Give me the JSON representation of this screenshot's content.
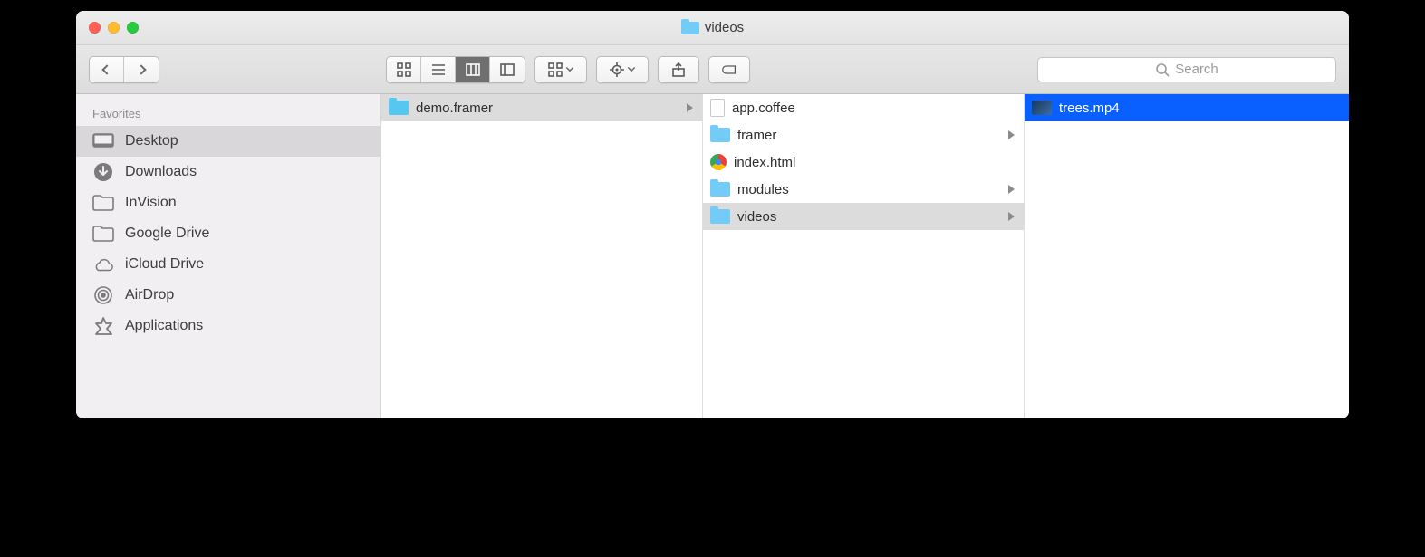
{
  "window": {
    "title": "videos"
  },
  "toolbar": {
    "search_placeholder": "Search"
  },
  "sidebar": {
    "heading": "Favorites",
    "items": [
      {
        "label": "Desktop",
        "icon": "desktop",
        "selected": true
      },
      {
        "label": "Downloads",
        "icon": "download",
        "selected": false
      },
      {
        "label": "InVision",
        "icon": "folder",
        "selected": false
      },
      {
        "label": "Google Drive",
        "icon": "folder",
        "selected": false
      },
      {
        "label": "iCloud Drive",
        "icon": "cloud",
        "selected": false
      },
      {
        "label": "AirDrop",
        "icon": "airdrop",
        "selected": false
      },
      {
        "label": "Applications",
        "icon": "apps",
        "selected": false
      }
    ]
  },
  "columns": [
    {
      "items": [
        {
          "label": "demo.framer",
          "kind": "framer-folder",
          "has_children": true,
          "selected": "gray"
        }
      ]
    },
    {
      "items": [
        {
          "label": "app.coffee",
          "kind": "file",
          "has_children": false,
          "selected": "none"
        },
        {
          "label": "framer",
          "kind": "folder",
          "has_children": true,
          "selected": "none"
        },
        {
          "label": "index.html",
          "kind": "chrome",
          "has_children": false,
          "selected": "none"
        },
        {
          "label": "modules",
          "kind": "folder",
          "has_children": true,
          "selected": "none"
        },
        {
          "label": "videos",
          "kind": "folder",
          "has_children": true,
          "selected": "gray"
        }
      ]
    },
    {
      "items": [
        {
          "label": "trees.mp4",
          "kind": "video",
          "has_children": false,
          "selected": "blue"
        }
      ]
    }
  ]
}
